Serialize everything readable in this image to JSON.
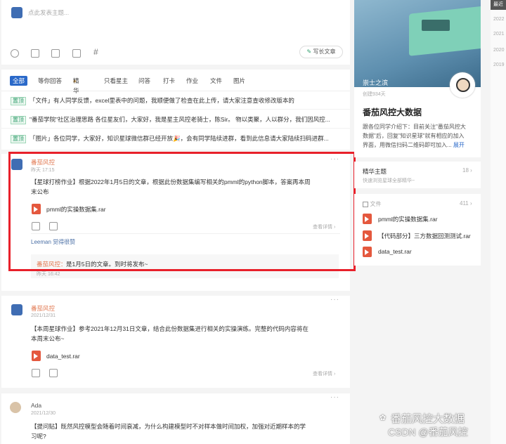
{
  "composer": {
    "placeholder": "点此发表主题...",
    "write_long": "写长文章"
  },
  "tabs": [
    "全部",
    "等你回答",
    "精华",
    "只看星主",
    "问答",
    "打卡",
    "作业",
    "文件",
    "图片"
  ],
  "notices": [
    {
      "tag": "置顶",
      "text": "「文件」有人同学反馈，excel里表中的问题，我顺便做了检查在此上传，请大家注意查收修改版本的"
    },
    {
      "tag": "置顶",
      "text": "\"番茄学院\"社区治理思路 各位星友们，大家好，我是星主风控老骑士，陈Sir。 物以类聚，人以群分，我们因风控..."
    },
    {
      "tag": "置顶",
      "text": "「图片」各位同学，大家好，知识星球微信群已经开放🎉，会有同学陆续进群，看到此信息请大家陆续扫码进群..."
    }
  ],
  "posts": [
    {
      "author": "番茄风控",
      "time": "昨天 17:15",
      "text_line1": "【星球打榜作业】根据2022年1月5日的文章，根据此份数据集编写相关的pmml的python脚本，答案再本周",
      "text_line2": "末公布",
      "file": "pmml的实操数据集.rar",
      "view_detail": "查看详情 ›",
      "liked_by": "Leeman 觉得很赞",
      "comment_author": "番茄风控：",
      "comment_text": "是1月5日的文章。到时将发布~",
      "comment_time": "昨天 16:42"
    },
    {
      "author": "番茄风控",
      "time": "2021/12/31",
      "text_line1": "【本周星球作业】参考2021年12月31日文章，结合此份数据集进行相关的实操演练。完整的代码内容将在",
      "text_line2": "本周末公布~",
      "file": "data_test.rar",
      "view_detail": "查看详情 ›"
    },
    {
      "author": "Ada",
      "time": "2021/12/30",
      "text_line1": "【提问贴】既然风控模型会随着时间衰减，为什么构建模型时不对样本做时间加权，加强对近期样本的学",
      "text_line2": "习呢?"
    }
  ],
  "sidebar": {
    "banner_name": "崇士之滨",
    "created": "创建934天",
    "title": "番茄风控大数据",
    "desc1": "跟各位同学介绍下：目前关注\"番茄风控大",
    "desc2": "数据\"后，回复\"知识星球\"就有相应的加入",
    "desc3": "界面，用微信扫码二维码即可加入...",
    "expand": "展开",
    "featured_label": "精华主题",
    "featured_count": "18 ›",
    "featured_hint": "快速浏览星球全部精华~",
    "files_label": "文件",
    "files_count": "411 ›",
    "files": [
      "pmml的实操数据集.rar",
      "【代码部分】三方数据回测测试.rar",
      "data_test.rar"
    ]
  },
  "timeline": {
    "header": "最近",
    "years": [
      "2022",
      "2021",
      "2020",
      "2019"
    ]
  },
  "watermark": {
    "line1": "番茄风控大数据",
    "line2": "CSDN @番茄风控"
  },
  "colors": {
    "accent": "#e27a53",
    "highlight": "#e8202a",
    "tag_green": "#2d9c6b",
    "file_red": "#e4583e"
  }
}
